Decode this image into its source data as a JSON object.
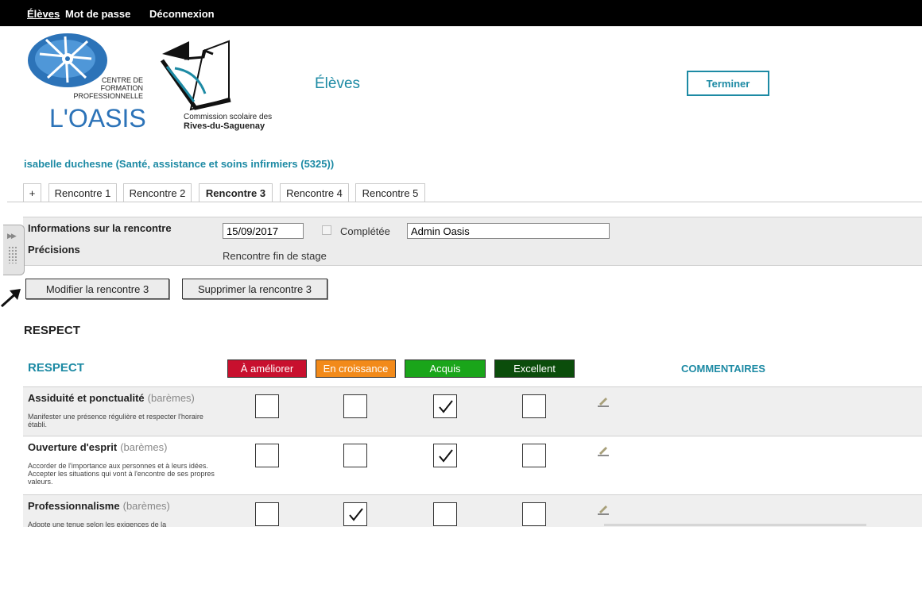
{
  "nav": {
    "items": [
      "Élèves",
      "Mot de passe",
      "Déconnexion"
    ]
  },
  "logo": {
    "oasis_line1": "CENTRE DE",
    "oasis_line2": "FORMATION",
    "oasis_line3": "PROFESSIONNELLE",
    "oasis_name": "L'OASIS",
    "cs_line1": "Commission scolaire des",
    "cs_line2": "Rives-du-Saguenay"
  },
  "header": {
    "title": "Élèves",
    "finish_label": "Terminer"
  },
  "student": {
    "label": "isabelle duchesne (Santé, assistance et soins infirmiers (5325))"
  },
  "tabs": [
    "+",
    "Rencontre 1",
    "Rencontre 2",
    "Rencontre 3",
    "Rencontre 4",
    "Rencontre 5"
  ],
  "meeting": {
    "info_label": "Informations sur la rencontre",
    "date": "15/09/2017",
    "completed_label": "Complétée",
    "user": "Admin Oasis",
    "details_label": "Précisions",
    "details_value": "Rencontre fin de stage"
  },
  "actions": {
    "edit_label": "Modifier la rencontre 3",
    "delete_label": "Supprimer la rencontre 3"
  },
  "section": {
    "title_prefix": "RE",
    "title_rest": "SPECT"
  },
  "grid": {
    "title_prefix": "RE",
    "title_rest": "SPECT",
    "levels": [
      {
        "label": "À améliorer",
        "color": "#c8102e"
      },
      {
        "label": "En croissance",
        "color": "#f28a1a"
      },
      {
        "label": "Acquis",
        "color": "#1aa51a"
      },
      {
        "label": "Excellent",
        "color": "#0b4d0b"
      }
    ],
    "comments_label": "COMMENTAIRES",
    "scale_label": "(barèmes)"
  },
  "criteria": [
    {
      "title_prefix": "A",
      "title_rest": "ssiduité et ponctualité",
      "desc_prefix": "Man",
      "desc_rest": "ifester une présence régulière et respecter l'horaire établi.",
      "checked": 2
    },
    {
      "title_prefix": "",
      "title_rest": "Ouverture d'esprit",
      "desc_prefix": "",
      "desc_rest": "Accorder de l'importance aux personnes et à leurs idées. Accepter les situations qui vont à l'encontre de ses propres valeurs.",
      "checked": 2
    },
    {
      "title_prefix": "",
      "title_rest": "Professionnalisme",
      "desc_prefix": "",
      "desc_rest": "Adopte une tenue selon les exigences de la",
      "checked": 1
    }
  ]
}
